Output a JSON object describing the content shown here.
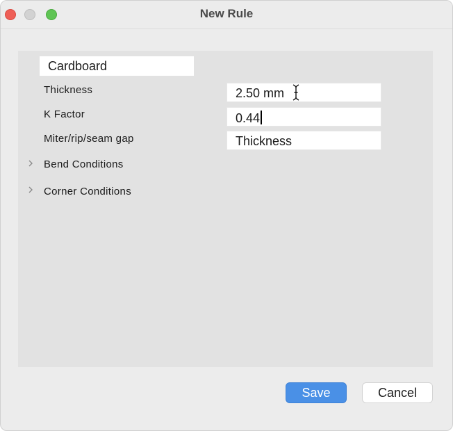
{
  "window": {
    "title": "New Rule"
  },
  "rule": {
    "name_value": "Cardboard",
    "fields": [
      {
        "label": "Thickness",
        "value": "2.50 mm"
      },
      {
        "label": "K Factor",
        "value": "0.44"
      },
      {
        "label": "Miter/rip/seam gap",
        "value": "Thickness"
      }
    ],
    "sections": [
      {
        "label": "Bend Conditions",
        "icon": "chevron-right-icon"
      },
      {
        "label": "Corner Conditions",
        "icon": "chevron-right-icon"
      }
    ]
  },
  "buttons": {
    "save_label": "Save",
    "cancel_label": "Cancel"
  },
  "colors": {
    "accent": "#4a90e6",
    "close": "#ee5f57",
    "minimize_inactive": "#d2d2d2",
    "maximize": "#5fc454"
  }
}
